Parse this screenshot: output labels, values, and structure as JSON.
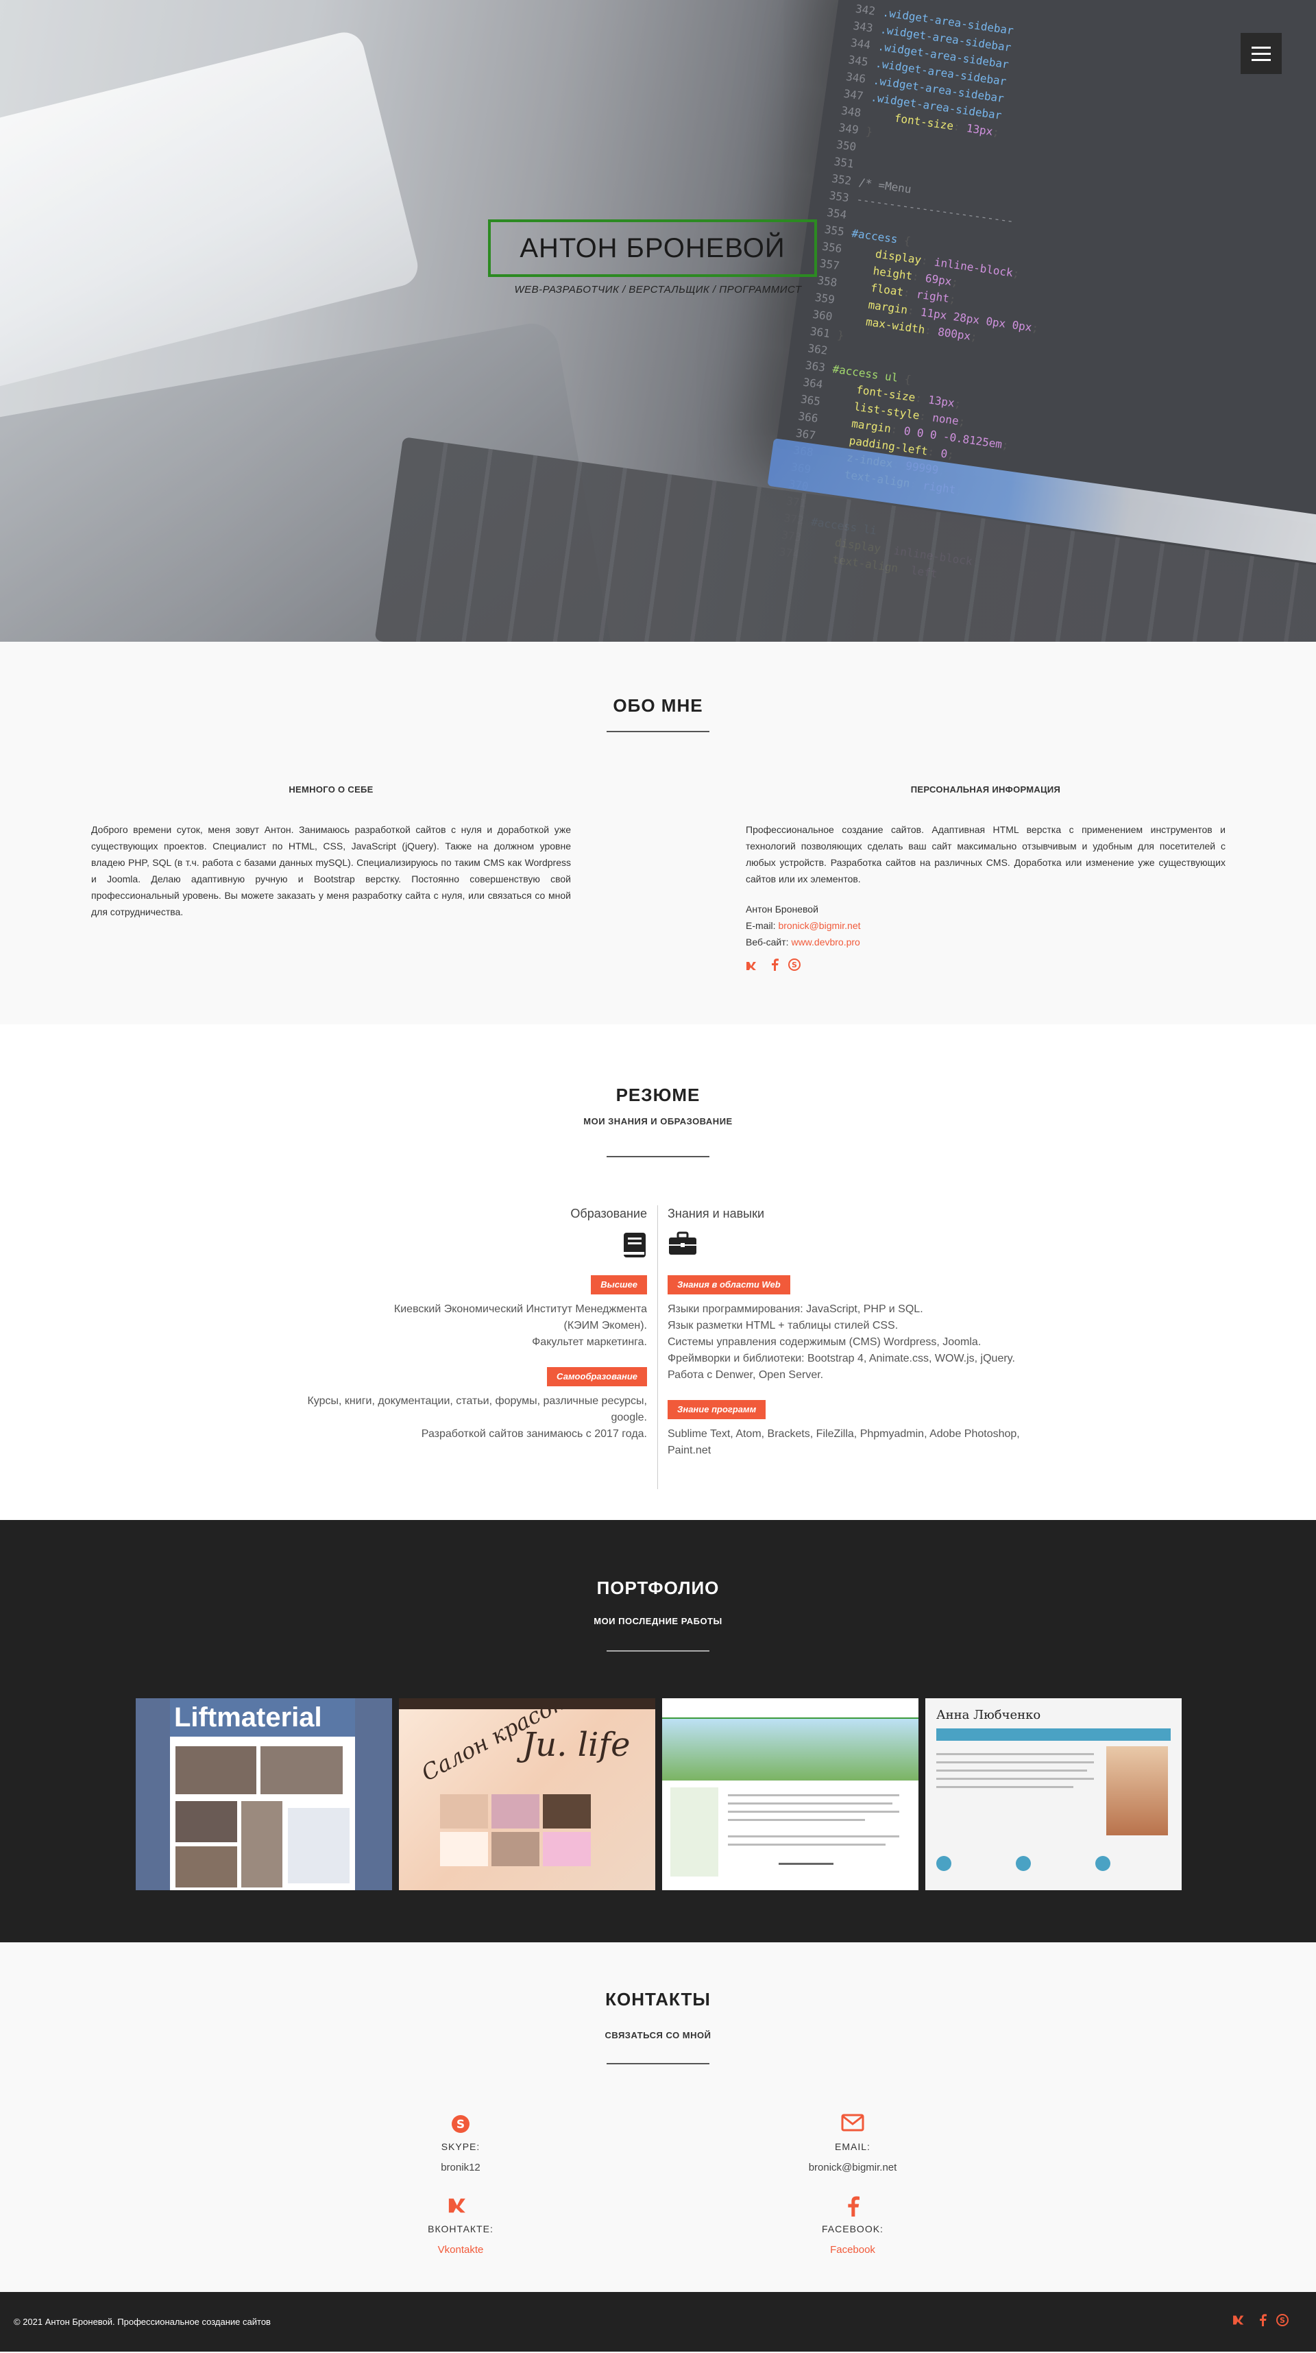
{
  "hero": {
    "title": "АНТОН БРОНЕВОЙ",
    "subtitle": "WEB-РАЗРАБОТЧИК / ВЕРСТАЛЬЩИК / ПРОГРАММИСТ"
  },
  "about": {
    "title": "ОБО МНЕ",
    "left_heading": "НЕМНОГО О СЕБЕ",
    "left_text": "Доброго времени суток, меня зовут Антон. Занимаюсь разработкой сайтов с нуля и доработкой уже существующих проектов. Специалист по HTML, CSS, JavaScript (jQuery). Также на должном уровне владею PHP, SQL (в т.ч. работа с базами данных mySQL). Специализируюсь по таким CMS как Wordpress и Joomla. Делаю адаптивную ручную и Bootstrap верстку. Постоянно совершенствую свой профессиональный уровень. Вы можете заказать у меня разработку сайта с нуля, или связаться со мной для сотрудничества.",
    "right_heading": "ПЕРСОНАЛЬНАЯ ИНФОРМАЦИЯ",
    "right_text": "Профессиональное создание сайтов. Адаптивная HTML верстка с применением инструментов и технологий позволяющих сделать ваш сайт максимально отзывчивым и удобным для посетителей с любых устройств. Разработка сайтов на различных CMS. Доработка или изменение уже существующих сайтов или их элементов.",
    "name": "Антон Броневой",
    "email_label": "E-mail:",
    "email": "bronick@bigmir.net",
    "site_label": "Веб-сайт:",
    "site": "www.devbro.pro"
  },
  "resume": {
    "title": "РЕЗЮМЕ",
    "subtitle": "МОИ ЗНАНИЯ И ОБРАЗОВАНИЕ",
    "edu_heading": "Образование",
    "skills_heading": "Знания и навыки",
    "edu_tag1": "Высшее",
    "edu_lines1": [
      "Киевский Экономический Институт Менеджмента",
      "(КЭИМ Экомен).",
      "Факультет маркетинга."
    ],
    "edu_tag2": "Самообразование",
    "edu_lines2": [
      "Курсы, книги, документации, статьи, форумы, различные ресурсы,",
      "google.",
      "Разработкой сайтов занимаюсь с 2017 года."
    ],
    "skills_tag1": "Знания в области Web",
    "skills_lines1": [
      "Языки программирования: JavaScript, PHP и SQL.",
      "Язык разметки HTML + таблицы стилей CSS.",
      "Системы управления содержимым (CMS) Wordpress, Joomla.",
      "Фреймворки и библиотеки: Bootstrap 4, Animate.css, WOW.js, jQuery.",
      "Работа с Denwer, Open Server."
    ],
    "skills_tag2": "Знание программ",
    "skills_lines2": [
      "Sublime Text, Atom, Brackets, FileZilla, Phpmyadmin, Adobe Photoshop,",
      "Paint.net"
    ]
  },
  "portfolio": {
    "title": "ПОРТФОЛИО",
    "subtitle": "МОИ ПОСЛЕДНИЕ РАБОТЫ",
    "t1_logo": "Liftmaterial",
    "t2_text1": "Салон красоты",
    "t2_text2": "Ju. life",
    "t4_name": "Анна Любченко"
  },
  "contacts": {
    "title": "КОНТАКТЫ",
    "subtitle": "СВЯЗАТЬСЯ СО МНОЙ",
    "skype_label": "SKYPE:",
    "skype_value": "bronik12",
    "email_label": "EMAIL:",
    "email_value": "bronick@bigmir.net",
    "vk_label": "ВКОНТАКТЕ:",
    "vk_value": "Vkontakte",
    "fb_label": "FACEBOOK:",
    "fb_value": "Facebook"
  },
  "footer": {
    "copyright": "© 2021 Антон Броневой. Профессиональное создание сайтов"
  },
  "colors": {
    "accent": "#f15a3a",
    "title_border": "#2c8a22",
    "dark_bg": "#222222"
  },
  "icons": [
    "menu-icon",
    "vk-icon",
    "facebook-icon",
    "skype-icon",
    "book-icon",
    "briefcase-icon",
    "email-icon"
  ]
}
